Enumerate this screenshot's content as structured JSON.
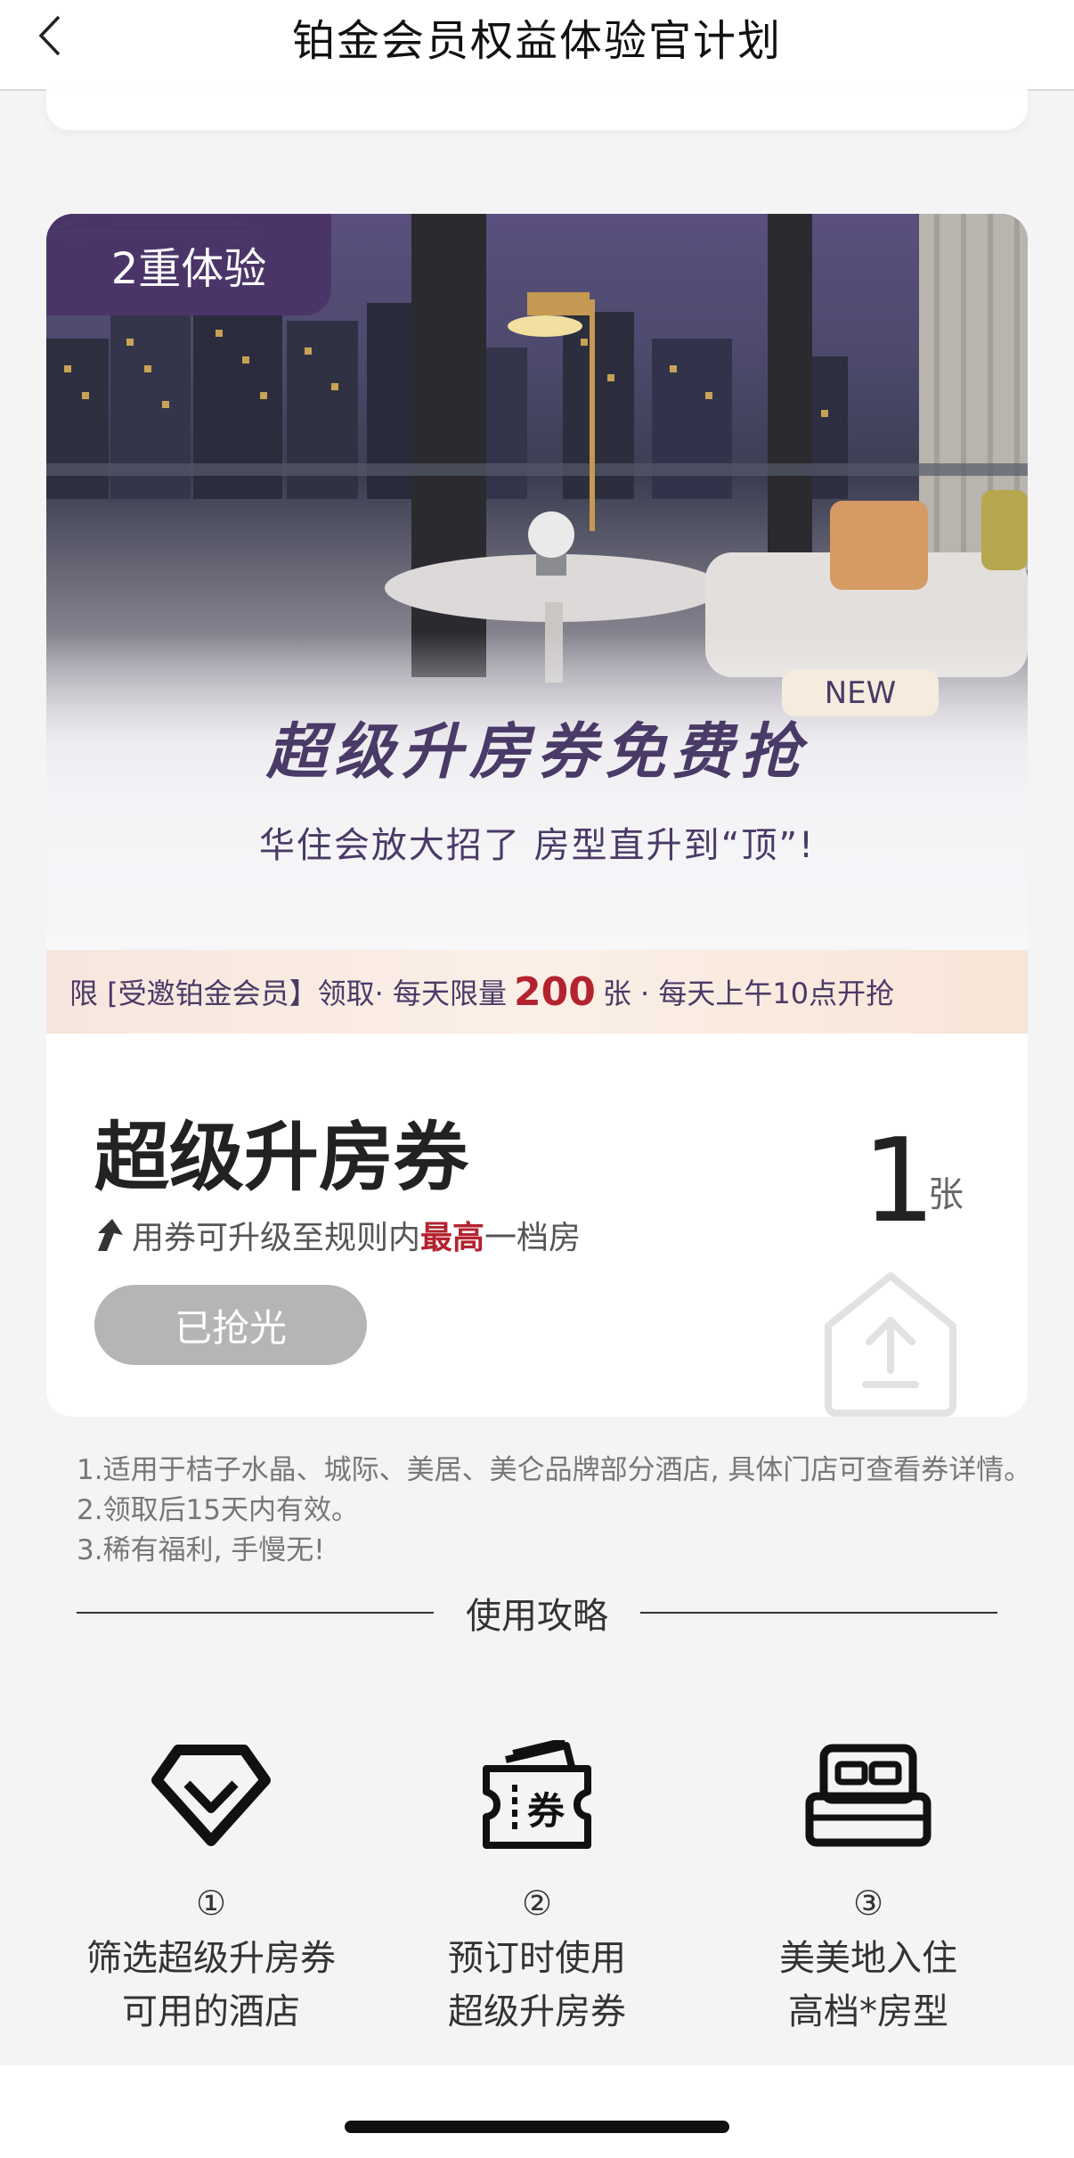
{
  "nav": {
    "title": "铂金会员权益体验官计划",
    "back_icon": "chevron-left-icon"
  },
  "card": {
    "tag": "2重体验",
    "new_badge": "NEW",
    "headline": "超级升房券免费抢",
    "subline": "华住会放大招了 房型直升到“顶”!",
    "limit": {
      "prefix": "限 [受邀铂金会员】领取· 每天限量",
      "count": "200",
      "suffix": "张 · 每天上午10点开抢"
    },
    "coupon": {
      "title": "超级升房券",
      "desc_prefix": "用券可升级至规则内 ",
      "desc_highlight": "最高",
      "desc_suffix": "一档房",
      "button": "已抢光",
      "count": "1",
      "unit": "张",
      "icon": "house-upload-icon"
    }
  },
  "notes": [
    "1.适用于桔子水晶、城际、美居、美仑品牌部分酒店, 具体门店可查看券详情。",
    "2.领取后15天内有效。",
    "3.稀有福利, 手慢无!"
  ],
  "guide": {
    "title": "使用攻略",
    "steps": [
      {
        "num": "①",
        "line1": "筛选超级升房券",
        "line2": "可用的酒店",
        "icon": "diamond-icon"
      },
      {
        "num": "②",
        "line1": "预订时使用",
        "line2": "超级升房券",
        "icon": "ticket-icon"
      },
      {
        "num": "③",
        "line1": "美美地入住",
        "line2": "高档*房型",
        "icon": "bed-icon"
      }
    ]
  },
  "colors": {
    "brand_purple": "#4a3a67",
    "highlight_red": "#b3232f",
    "disabled_gray": "#b5b5b5"
  }
}
